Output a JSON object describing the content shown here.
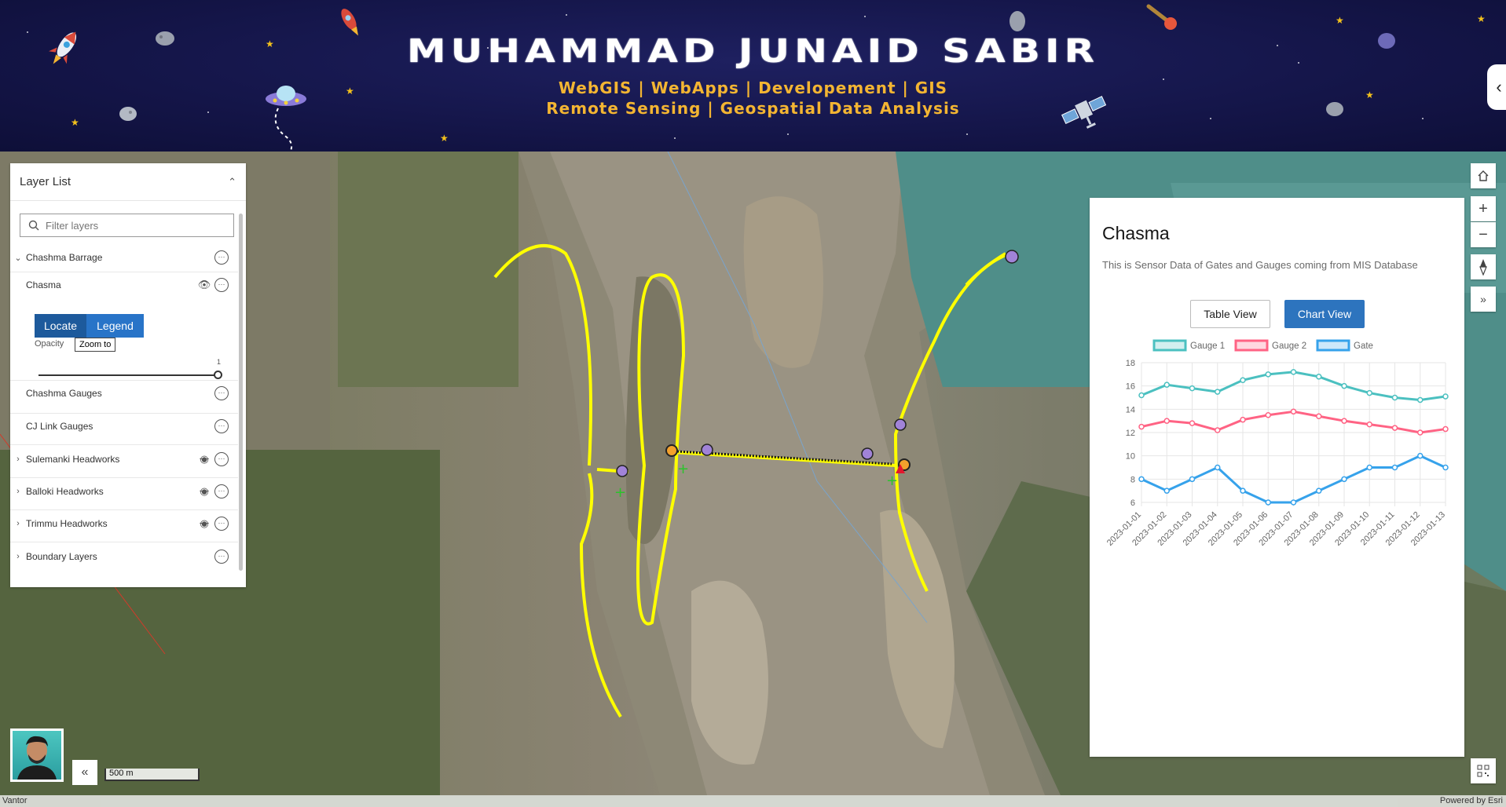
{
  "banner": {
    "title": "MUHAMMAD JUNAID SABIR",
    "subtitle_line1": "WebGIS | WebApps | Developement | GIS",
    "subtitle_line2": "Remote Sensing | Geospatial Data Analysis"
  },
  "layer_list": {
    "title": "Layer List",
    "filter_placeholder": "Filter layers",
    "items": [
      {
        "label": "Chashma Barrage",
        "expanded": true
      },
      {
        "label": "Chasma",
        "visible": true
      },
      {
        "label": "Chashma Gauges"
      },
      {
        "label": "CJ Link Gauges"
      },
      {
        "label": "Sulemanki Headworks",
        "visible": false
      },
      {
        "label": "Balloki Headworks",
        "visible": false
      },
      {
        "label": "Trimmu Headworks",
        "visible": false
      },
      {
        "label": "Boundary Layers"
      }
    ],
    "actions": {
      "locate": "Locate",
      "legend": "Legend",
      "tooltip": "Zoom to"
    },
    "opacity_label": "Opacity",
    "opacity_value": "1"
  },
  "panel": {
    "title": "Chasma",
    "description": "This is Sensor Data of Gates and Gauges coming from MIS Database",
    "table_view": "Table View",
    "chart_view": "Chart View"
  },
  "chart_data": {
    "type": "line",
    "categories": [
      "2023-01-01",
      "2023-01-02",
      "2023-01-03",
      "2023-01-04",
      "2023-01-05",
      "2023-01-06",
      "2023-01-07",
      "2023-01-08",
      "2023-01-09",
      "2023-01-10",
      "2023-01-11",
      "2023-01-12",
      "2023-01-13"
    ],
    "series": [
      {
        "name": "Gauge 1",
        "color": "#4bc0c0",
        "values": [
          15.2,
          16.1,
          15.8,
          15.5,
          16.5,
          17.0,
          17.2,
          16.8,
          16.0,
          15.4,
          15.0,
          14.8,
          15.1
        ]
      },
      {
        "name": "Gauge 2",
        "color": "#ff6384",
        "values": [
          12.5,
          13.0,
          12.8,
          12.2,
          13.1,
          13.5,
          13.8,
          13.4,
          13.0,
          12.7,
          12.4,
          12.0,
          12.3
        ]
      },
      {
        "name": "Gate",
        "color": "#36a2eb",
        "values": [
          8,
          7,
          8,
          9,
          7,
          6,
          6,
          7,
          8,
          9,
          9,
          10,
          9
        ]
      }
    ],
    "ylim": [
      6,
      18
    ],
    "yticks": [
      6,
      8,
      10,
      12,
      14,
      16,
      18
    ],
    "legend": "top",
    "grid": true
  },
  "map": {
    "scale_label": "500 m",
    "attribution_left": "Vantor",
    "attribution_right": "Powered by Esri"
  },
  "colors": {
    "accent": "#2d74be",
    "feature_yellow": "#ffff00",
    "banner_bg": "#141548",
    "banner_sub": "#f3b532"
  }
}
